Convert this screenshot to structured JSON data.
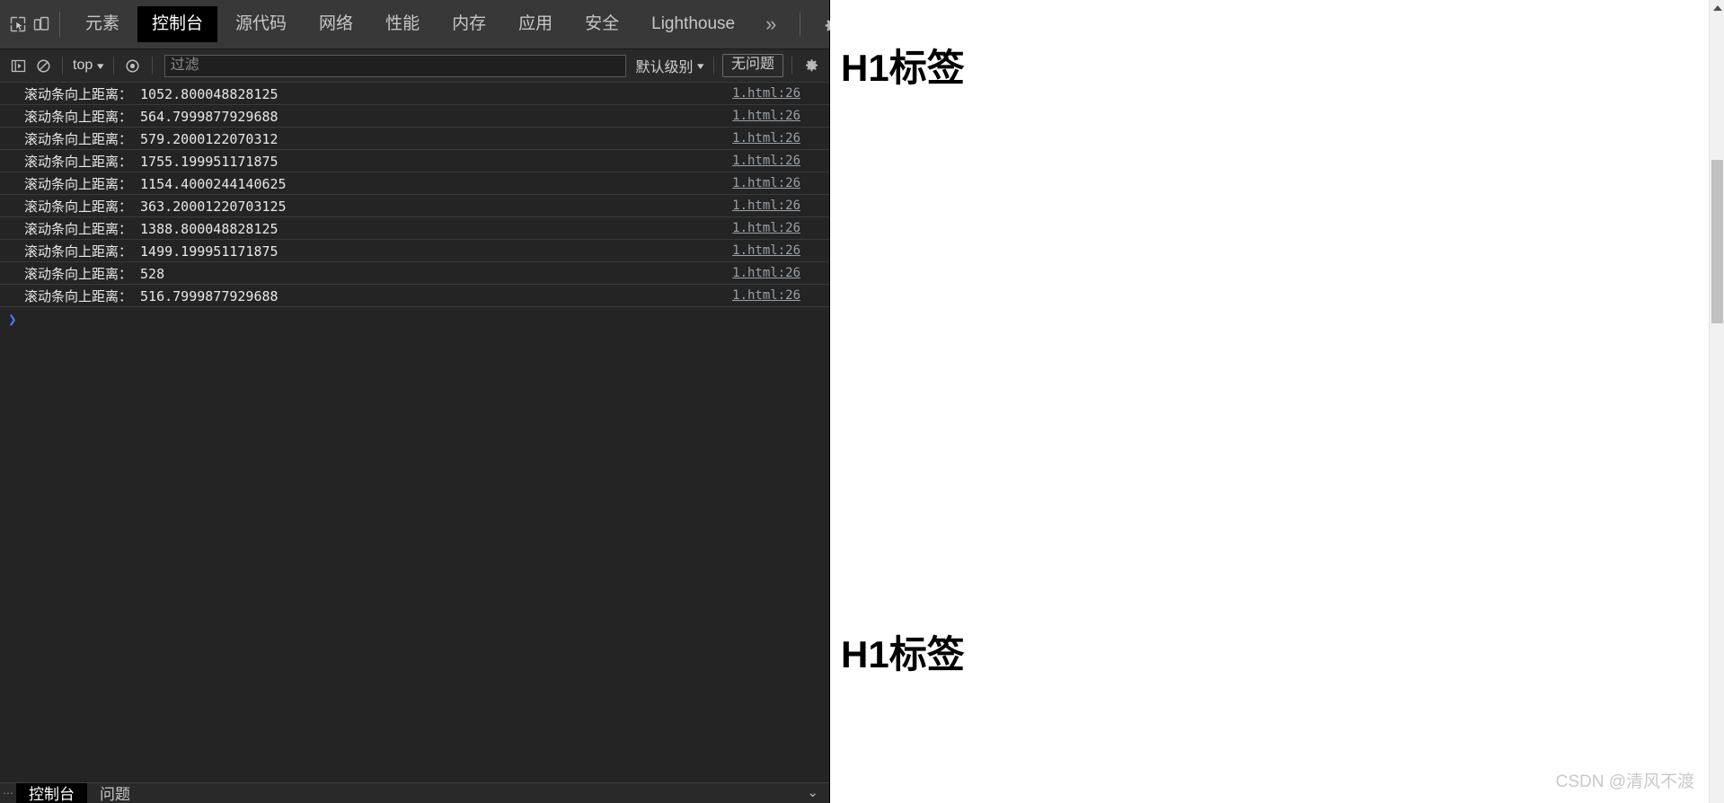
{
  "devtools": {
    "toolbar": {
      "inspect_icon": "inspect-cursor-icon",
      "device_toggle_icon": "device-toolbar-icon",
      "tabs": [
        {
          "label": "元素",
          "selected": false
        },
        {
          "label": "控制台",
          "selected": true
        },
        {
          "label": "源代码",
          "selected": false
        },
        {
          "label": "网络",
          "selected": false
        },
        {
          "label": "性能",
          "selected": false
        },
        {
          "label": "内存",
          "selected": false
        },
        {
          "label": "应用",
          "selected": false
        },
        {
          "label": "安全",
          "selected": false
        },
        {
          "label": "Lighthouse",
          "selected": false
        }
      ],
      "more_tabs_label": "»",
      "settings_icon": "gear-icon",
      "more_options_icon": "kebab-menu-icon",
      "close_icon": "close-icon"
    },
    "filterbar": {
      "sidebar_toggle_icon": "show-console-sidebar-icon",
      "clear_icon": "clear-console-icon",
      "context": "top",
      "eye_icon": "live-expression-icon",
      "filter_placeholder": "过滤",
      "filter_value": "",
      "levels_label": "默认级别",
      "issues_label": "无问题",
      "settings_icon": "console-settings-gear-icon"
    },
    "console": {
      "source_link": "1.html:26",
      "messages": [
        {
          "text": "滚动条向上距离： 1052.800048828125",
          "source": "1.html:26"
        },
        {
          "text": "滚动条向上距离： 564.7999877929688",
          "source": "1.html:26"
        },
        {
          "text": "滚动条向上距离： 579.2000122070312",
          "source": "1.html:26"
        },
        {
          "text": "滚动条向上距离： 1755.199951171875",
          "source": "1.html:26"
        },
        {
          "text": "滚动条向上距离： 1154.4000244140625",
          "source": "1.html:26"
        },
        {
          "text": "滚动条向上距离： 363.20001220703125",
          "source": "1.html:26"
        },
        {
          "text": "滚动条向上距离： 1388.800048828125",
          "source": "1.html:26"
        },
        {
          "text": "滚动条向上距离： 1499.199951171875",
          "source": "1.html:26"
        },
        {
          "text": "滚动条向上距离： 528",
          "source": "1.html:26"
        },
        {
          "text": "滚动条向上距离： 516.7999877929688",
          "source": "1.html:26"
        }
      ],
      "prompt_caret": "❯"
    },
    "drawer": {
      "handle_icon": "drawer-handle-dots-icon",
      "tabs": [
        {
          "label": "控制台",
          "selected": true
        },
        {
          "label": "问题",
          "selected": false
        }
      ],
      "close_icon": "drawer-close-chevron-icon"
    }
  },
  "page": {
    "headings": [
      {
        "text": "H1标签"
      },
      {
        "text": "H1标签"
      }
    ],
    "watermark": "CSDN @清风不渡",
    "scrollbar": {
      "up_arrow_icon": "scroll-up-arrow-icon",
      "thumb_label": "scrollbar-thumb"
    }
  }
}
